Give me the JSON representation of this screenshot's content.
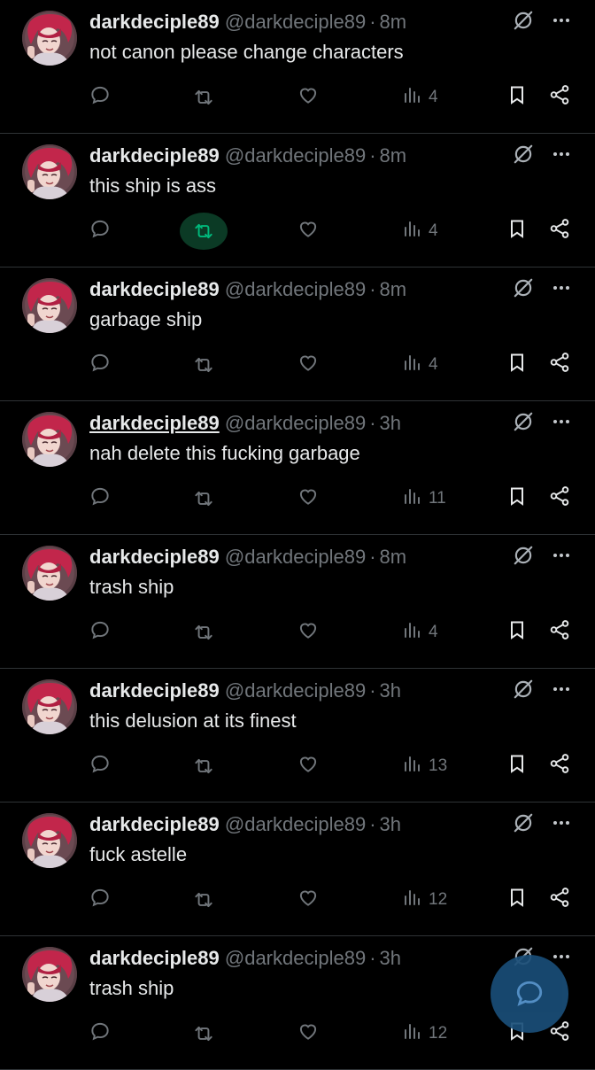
{
  "posts": [
    {
      "name": "darkdeciple89",
      "handle": "@darkdeciple89",
      "dot": "·",
      "time": "8m",
      "text": "not canon please change characters",
      "views": "4",
      "reposted": false,
      "underline": false
    },
    {
      "name": "darkdeciple89",
      "handle": "@darkdeciple89",
      "dot": "·",
      "time": "8m",
      "text": "this ship is ass",
      "views": "4",
      "reposted": true,
      "underline": false
    },
    {
      "name": "darkdeciple89",
      "handle": "@darkdeciple89",
      "dot": "·",
      "time": "8m",
      "text": "garbage ship",
      "views": "4",
      "reposted": false,
      "underline": false
    },
    {
      "name": "darkdeciple89",
      "handle": "@darkdeciple89",
      "dot": "·",
      "time": "3h",
      "text": "nah delete this fucking garbage",
      "views": "11",
      "reposted": false,
      "underline": true
    },
    {
      "name": "darkdeciple89",
      "handle": "@darkdeciple89",
      "dot": "·",
      "time": "8m",
      "text": "trash ship",
      "views": "4",
      "reposted": false,
      "underline": false
    },
    {
      "name": "darkdeciple89",
      "handle": "@darkdeciple89",
      "dot": "·",
      "time": "3h",
      "text": "this delusion at its finest",
      "views": "13",
      "reposted": false,
      "underline": false
    },
    {
      "name": "darkdeciple89",
      "handle": "@darkdeciple89",
      "dot": "·",
      "time": "3h",
      "text": "fuck astelle",
      "views": "12",
      "reposted": false,
      "underline": false
    },
    {
      "name": "darkdeciple89",
      "handle": "@darkdeciple89",
      "dot": "·",
      "time": "3h",
      "text": "trash ship",
      "views": "12",
      "reposted": false,
      "underline": false
    }
  ],
  "icons": {
    "reply": "reply-icon",
    "repost": "repost-icon",
    "like": "heart-icon",
    "views": "views-icon",
    "bookmark": "bookmark-icon",
    "share": "share-icon",
    "grok": "grok-icon",
    "more": "more-icon",
    "compose": "compose-icon"
  },
  "colors": {
    "background": "#000000",
    "text": "#e7e9ea",
    "muted": "#71767b",
    "repost_active": "#00ba7c",
    "fab": "#1d9bf0"
  }
}
